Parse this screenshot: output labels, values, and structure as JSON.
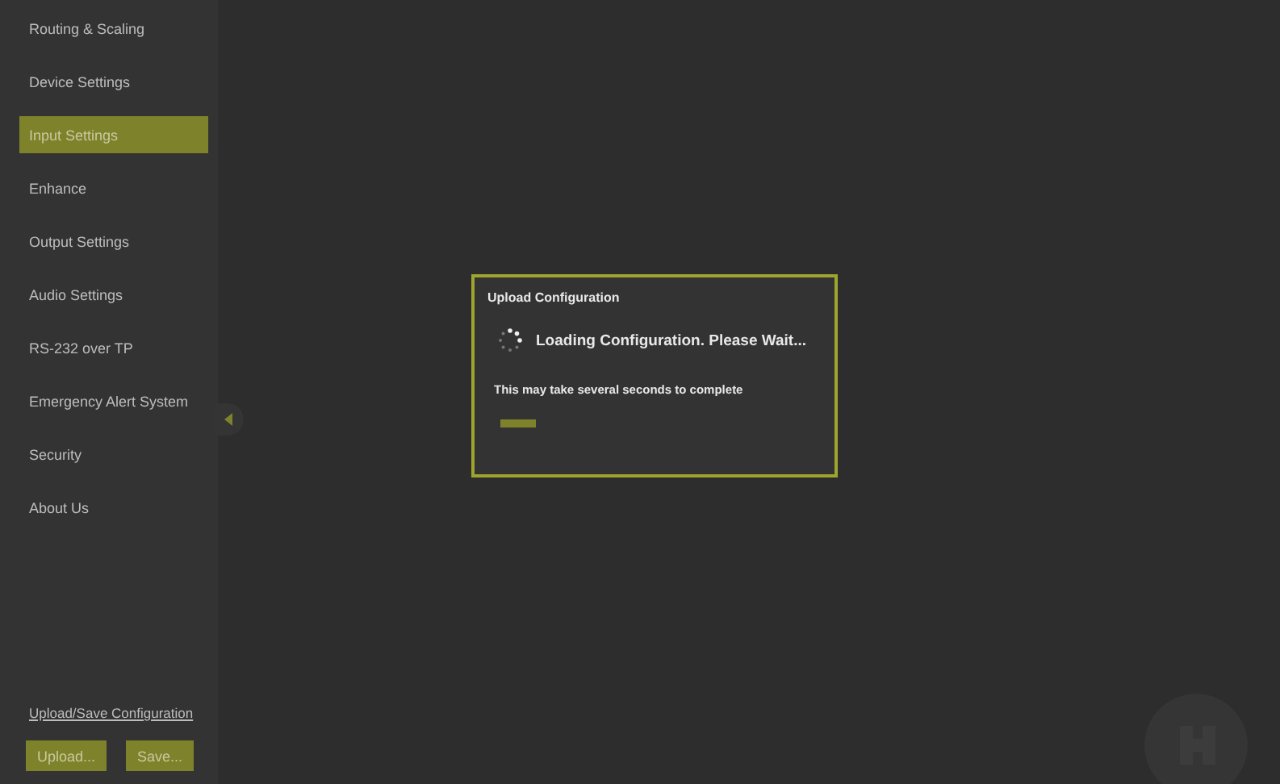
{
  "sidebar": {
    "items": [
      {
        "label": "Routing & Scaling",
        "selected": false
      },
      {
        "label": "Device Settings",
        "selected": false
      },
      {
        "label": "Input Settings",
        "selected": true
      },
      {
        "label": "Enhance",
        "selected": false
      },
      {
        "label": "Output Settings",
        "selected": false
      },
      {
        "label": "Audio Settings",
        "selected": false
      },
      {
        "label": "RS-232 over TP",
        "selected": false
      },
      {
        "label": "Emergency Alert System",
        "selected": false
      },
      {
        "label": "Security",
        "selected": false
      },
      {
        "label": "About Us",
        "selected": false
      }
    ],
    "config_link": "Upload/Save Configuration",
    "buttons": [
      "Upload...",
      "Save..."
    ]
  },
  "dialog": {
    "title": "Upload Configuration",
    "message": "Loading Configuration. Please Wait...",
    "note": "This may take several seconds to complete",
    "progress": {
      "level": 0.11
    }
  }
}
